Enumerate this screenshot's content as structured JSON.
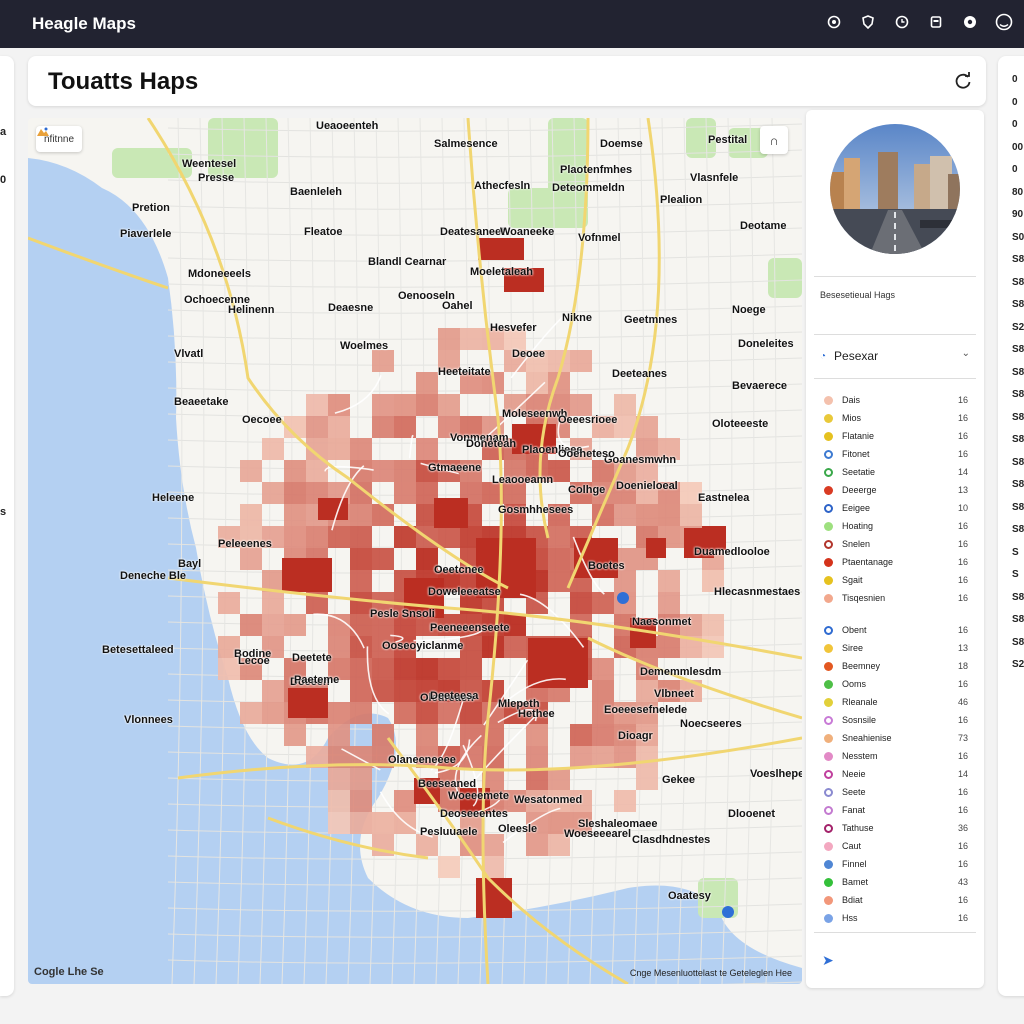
{
  "app": {
    "title": "Heagle Maps"
  },
  "page": {
    "title": "Touatts Haps"
  },
  "topbar_icons": [
    "at-icon",
    "shield-icon",
    "clock-icon",
    "clipboard-icon",
    "message-icon",
    "profile-icon"
  ],
  "left_strip": [
    "a",
    "0",
    "s"
  ],
  "map": {
    "layer_chip": "nfitnne",
    "labels": [
      {
        "t": "Ueaoeenteh"
      },
      {
        "t": "Salmesence"
      },
      {
        "t": "Doemse"
      },
      {
        "t": "Pestital"
      },
      {
        "t": "Weentesel"
      },
      {
        "t": "Presse"
      },
      {
        "t": "Plaotenfmhes"
      },
      {
        "t": "Vlasnfele"
      },
      {
        "t": "Pretion"
      },
      {
        "t": "Baenleleh"
      },
      {
        "t": "Athecfesln"
      },
      {
        "t": "Deteommeldn"
      },
      {
        "t": "Plealion"
      },
      {
        "t": "Piaverlele"
      },
      {
        "t": "Fleatoe"
      },
      {
        "t": "Deatesaneet"
      },
      {
        "t": "Woaneeke"
      },
      {
        "t": "Vofnmel"
      },
      {
        "t": "Deotame"
      },
      {
        "t": "Blandl Cearnar"
      },
      {
        "t": "Mdoneeeels"
      },
      {
        "t": "Moeletaleah"
      },
      {
        "t": "Ochoecenne"
      },
      {
        "t": "Helinenn"
      },
      {
        "t": "Deaesne"
      },
      {
        "t": "Oenooseln"
      },
      {
        "t": "Oahel"
      },
      {
        "t": "Nikne"
      },
      {
        "t": "Geetmnes"
      },
      {
        "t": "Noege"
      },
      {
        "t": "Hesvefer"
      },
      {
        "t": "Woelmes"
      },
      {
        "t": "Deoee"
      },
      {
        "t": "Vlvatl"
      },
      {
        "t": "Doneleites"
      },
      {
        "t": "Heeteitate"
      },
      {
        "t": "Deeteanes"
      },
      {
        "t": "Beaeetake"
      },
      {
        "t": "Bevaerece"
      },
      {
        "t": "Oecoee"
      },
      {
        "t": "Moleseenwh"
      },
      {
        "t": "Oeeesrioee"
      },
      {
        "t": "Oloteeeste"
      },
      {
        "t": "Vonmenam"
      },
      {
        "t": "Doneteah"
      },
      {
        "t": "Plaoenlieee"
      },
      {
        "t": "Goanesmwhn"
      },
      {
        "t": "Gtmaeene"
      },
      {
        "t": "Ooeheteso"
      },
      {
        "t": "Leaooeamn"
      },
      {
        "t": "Doenieloeal"
      },
      {
        "t": "Eastnelea"
      },
      {
        "t": "Gosmhhesees"
      },
      {
        "t": "Colhge"
      },
      {
        "t": "Heleene"
      },
      {
        "t": "Peleeenes"
      },
      {
        "t": "Duamedlooloe"
      },
      {
        "t": "Deneche Ble"
      },
      {
        "t": "Bayl"
      },
      {
        "t": "Boetes"
      },
      {
        "t": "Oeetcnee"
      },
      {
        "t": "Hlecasnmestaes"
      },
      {
        "t": "Betesettaleed"
      },
      {
        "t": "Bodine"
      },
      {
        "t": "Pesle Snsoli"
      },
      {
        "t": "Peeneeenseete"
      },
      {
        "t": "Doweleeeatse"
      },
      {
        "t": "Ooseoyiclanme"
      },
      {
        "t": "Naesonmet"
      },
      {
        "t": "Deetete"
      },
      {
        "t": "Lecoe"
      },
      {
        "t": "Doeeeh"
      },
      {
        "t": "Dememmlesdm"
      },
      {
        "t": "Oledreaen"
      },
      {
        "t": "Vlbneet"
      },
      {
        "t": "Vlonnees"
      },
      {
        "t": "Mlepeth"
      },
      {
        "t": "Paeteme"
      },
      {
        "t": "Deeteesa"
      },
      {
        "t": "Noecseeres"
      },
      {
        "t": "Olaneeneeee"
      },
      {
        "t": "Beeseaned"
      },
      {
        "t": "Eoeeesefnelede"
      },
      {
        "t": "Dioagr"
      },
      {
        "t": "Hethee"
      },
      {
        "t": "Wesatonmed"
      },
      {
        "t": "Gekee"
      },
      {
        "t": "Woeeemete"
      },
      {
        "t": "Deoseeentes"
      },
      {
        "t": "Sleshaleomaee"
      },
      {
        "t": "Oleesle"
      },
      {
        "t": "Voeslhepemels"
      },
      {
        "t": "Woeseeearel"
      },
      {
        "t": "Clasdhdnestes"
      },
      {
        "t": "Dlooenet"
      },
      {
        "t": "Oaatesy"
      },
      {
        "t": "Pesluuaele"
      }
    ],
    "google_logo": "Cogle Lhe Se",
    "attribution": "Cnge Mesenluottelast te Geteleglen Hee"
  },
  "side_panel": {
    "section_label": "Besesetieual Hags",
    "dropdown_label": "Pesexar",
    "legend": [
      {
        "label": "Dais",
        "value": "16",
        "color": "#f4c1ad",
        "ring": false
      },
      {
        "label": "Mios",
        "value": "16",
        "color": "#e9c93a",
        "ring": false
      },
      {
        "label": "Flatanie",
        "value": "16",
        "color": "#e5c120",
        "ring": false
      },
      {
        "label": "Fitonet",
        "value": "16",
        "color": "#3d7ad1",
        "ring": true
      },
      {
        "label": "Seetatie",
        "value": "14",
        "color": "#3aa84a",
        "ring": true
      },
      {
        "label": "Deeerge",
        "value": "13",
        "color": "#d93b23",
        "ring": false
      },
      {
        "label": "Eeigee",
        "value": "10",
        "color": "#2d63c8",
        "ring": true
      },
      {
        "label": "Hoating",
        "value": "16",
        "color": "#9ee07f",
        "ring": false
      },
      {
        "label": "Snelen",
        "value": "16",
        "color": "#b2352c",
        "ring": true
      },
      {
        "label": "Ptaentanage",
        "value": "16",
        "color": "#d4331b",
        "ring": false
      },
      {
        "label": "Sgait",
        "value": "16",
        "color": "#e6c21f",
        "ring": false
      },
      {
        "label": "Tisqesnien",
        "value": "16",
        "color": "#f2a88d",
        "ring": false
      },
      {
        "label": "Obent",
        "value": "16",
        "color": "#2f6bd1",
        "ring": true
      },
      {
        "label": "Siree",
        "value": "13",
        "color": "#f1c53a",
        "ring": false
      },
      {
        "label": "Beemney",
        "value": "18",
        "color": "#e35821",
        "ring": false
      },
      {
        "label": "Ooms",
        "value": "16",
        "color": "#4ebf47",
        "ring": false
      },
      {
        "label": "Rleanale",
        "value": "46",
        "color": "#e2d03a",
        "ring": false
      },
      {
        "label": "Sosnsile",
        "value": "16",
        "color": "#c87ad6",
        "ring": true
      },
      {
        "label": "Sneahienise",
        "value": "73",
        "color": "#f0b07c",
        "ring": false
      },
      {
        "label": "Nesstem",
        "value": "16",
        "color": "#e28ac6",
        "ring": false
      },
      {
        "label": "Neeie",
        "value": "14",
        "color": "#c0409d",
        "ring": true
      },
      {
        "label": "Seete",
        "value": "16",
        "color": "#8a8ad0",
        "ring": true
      },
      {
        "label": "Fanat",
        "value": "16",
        "color": "#c37ad0",
        "ring": true
      },
      {
        "label": "Tathuse",
        "value": "36",
        "color": "#a3226a",
        "ring": true
      },
      {
        "label": "Caut",
        "value": "16",
        "color": "#f3a8c0",
        "ring": false
      },
      {
        "label": "Finnel",
        "value": "16",
        "color": "#4f86d4",
        "ring": false
      },
      {
        "label": "Bamet",
        "value": "43",
        "color": "#34c03a",
        "ring": false
      },
      {
        "label": "Bdiat",
        "value": "16",
        "color": "#f2977a",
        "ring": false
      },
      {
        "label": "Hss",
        "value": "16",
        "color": "#7aa3e6",
        "ring": false
      }
    ]
  },
  "right_strip": [
    "0",
    "0",
    "0",
    "00",
    "0",
    "80",
    "90",
    "S0",
    "S8",
    "S8",
    "S8",
    "S2",
    "S8",
    "S8",
    "S8",
    "S8",
    "S8",
    "S8",
    "S8",
    "S8",
    "S8",
    "S",
    "S",
    "S8",
    "S8",
    "S8",
    "S2"
  ],
  "colors": {
    "topbar": "#222331",
    "water": "#b4d0f2",
    "choropleth_dark": "#b8261a",
    "choropleth_light": "#f6cfbf",
    "park": "#c9e8b5",
    "road": "#f1d671"
  }
}
